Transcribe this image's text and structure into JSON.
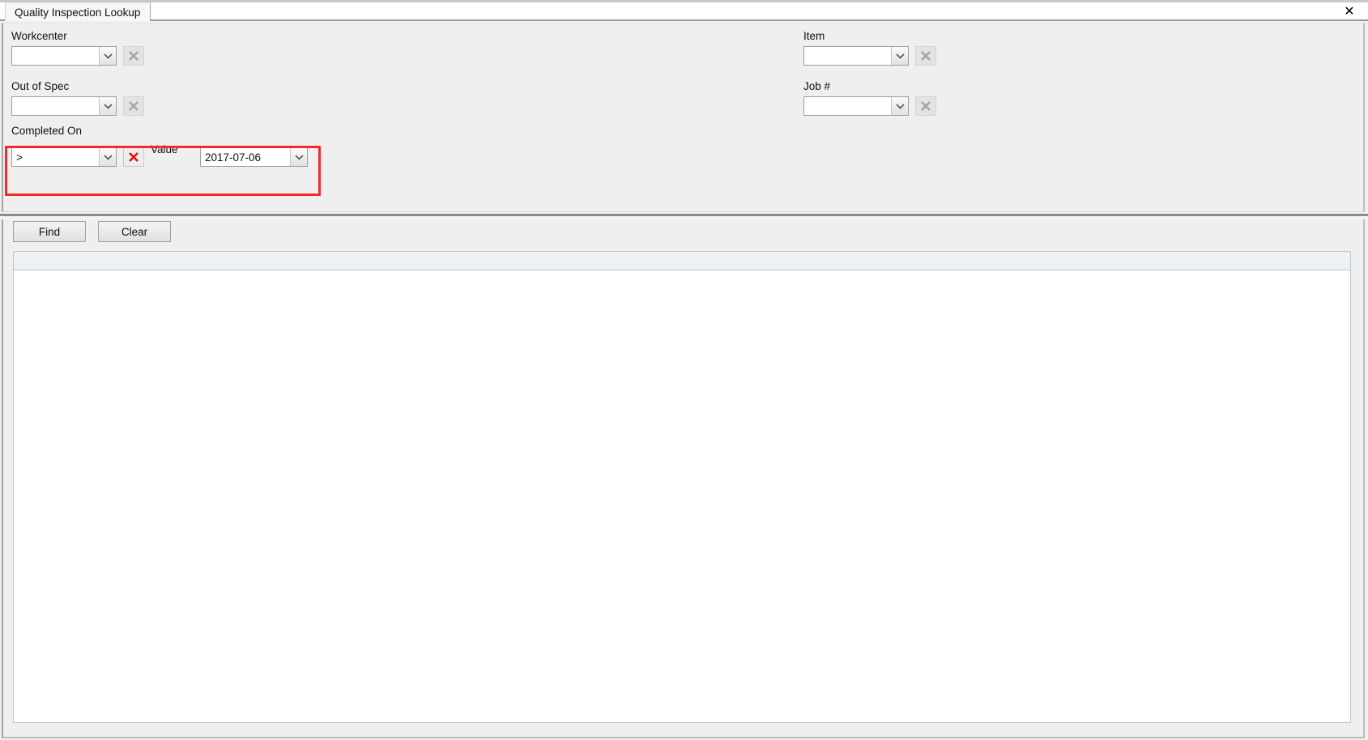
{
  "window": {
    "title": "Quality Inspection Lookup"
  },
  "tabs": {
    "items": [
      {
        "label": "Quality Inspection Lookup",
        "active": true
      }
    ],
    "close_glyph": "✕",
    "close_icon": "close-icon"
  },
  "filters": {
    "left_column": [
      {
        "id": "workcenter",
        "label": "Workcenter",
        "value": "",
        "placeholder": "",
        "clear_enabled": false,
        "clear_icon": "close-x-icon",
        "arrow_icon": "chevron-down-icon"
      },
      {
        "id": "out-of-spec",
        "label": "Out of Spec",
        "value": "",
        "placeholder": "",
        "clear_enabled": false,
        "clear_icon": "close-x-icon",
        "arrow_icon": "chevron-down-icon"
      }
    ],
    "right_column": [
      {
        "id": "item",
        "label": "Item",
        "value": "",
        "placeholder": "",
        "clear_enabled": false,
        "clear_icon": "close-x-icon",
        "arrow_icon": "chevron-down-icon"
      },
      {
        "id": "job-number",
        "label": "Job #",
        "value": "",
        "placeholder": "",
        "clear_enabled": false,
        "clear_icon": "close-x-icon",
        "arrow_icon": "chevron-down-icon"
      }
    ],
    "completed_on": {
      "id": "completed-on",
      "label": "Completed On",
      "operator_value": ">",
      "operator_options": [
        ">",
        ">=",
        "<",
        "<=",
        "=",
        "<>"
      ],
      "clear_enabled": true,
      "clear_icon": "close-x-icon",
      "value_label": "Value",
      "date_value": "2017-07-06",
      "arrow_icon": "chevron-down-icon",
      "highlight_color": "#f42a2a",
      "highlighted": true
    }
  },
  "actions": {
    "find_label": "Find",
    "clear_label": "Clear"
  },
  "results": {
    "columns": [],
    "rows": [],
    "row_count": 0
  },
  "colors": {
    "panel_background": "#efefef",
    "grid_header": "#eef1f4",
    "grid_border": "#b9c6d6",
    "accent_red": "#f42a2a",
    "button_face": "#eaeaea",
    "disabled_icon": "#9e9e9e"
  }
}
